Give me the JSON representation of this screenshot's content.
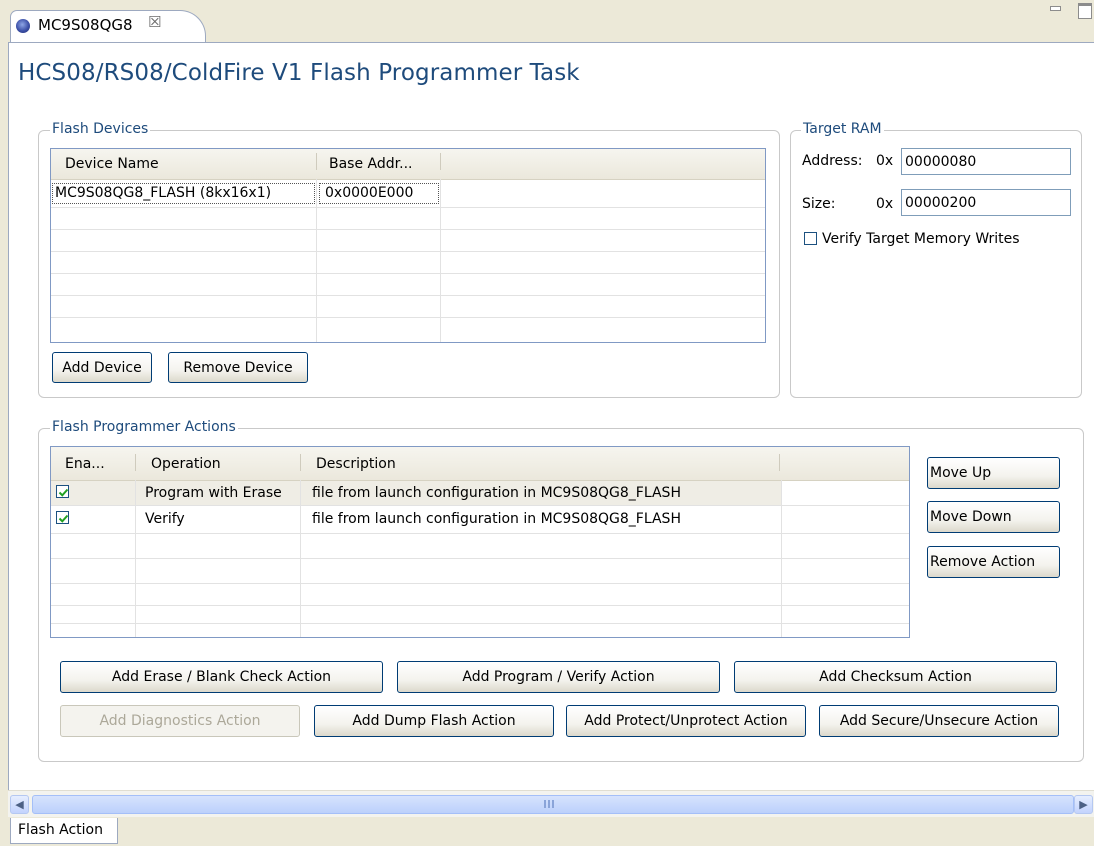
{
  "tab": {
    "title": "MC9S08QG8",
    "close_glyph": "☒"
  },
  "page": {
    "title": "HCS08/RS08/ColdFire V1 Flash Programmer Task"
  },
  "flash_devices": {
    "legend": "Flash Devices",
    "columns": [
      "Device Name",
      "Base Addr..."
    ],
    "rows": [
      {
        "device_name": "MC9S08QG8_FLASH (8kx16x1)",
        "base_addr": "0x0000E000"
      }
    ],
    "add_device_label": "Add Device",
    "remove_device_label": "Remove Device"
  },
  "target_ram": {
    "legend": "Target RAM",
    "address_label": "Address:",
    "address_prefix": "0x",
    "address_value": "00000080",
    "size_label": "Size:",
    "size_prefix": "0x",
    "size_value": "00000200",
    "verify_label": "Verify Target Memory Writes",
    "verify_checked": false
  },
  "actions": {
    "legend": "Flash Programmer Actions",
    "columns": [
      "Ena...",
      "Operation",
      "Description"
    ],
    "rows": [
      {
        "enabled": true,
        "operation": "Program with Erase",
        "description": "file from launch configuration in MC9S08QG8_FLASH"
      },
      {
        "enabled": true,
        "operation": "Verify",
        "description": "file from launch configuration in MC9S08QG8_FLASH"
      }
    ],
    "move_up_label": "Move Up",
    "move_down_label": "Move Down",
    "remove_action_label": "Remove Action",
    "add_erase_label": "Add Erase / Blank Check Action",
    "add_program_label": "Add Program / Verify Action",
    "add_checksum_label": "Add Checksum Action",
    "add_diagnostics_label": "Add Diagnostics Action",
    "add_dump_label": "Add Dump Flash Action",
    "add_protect_label": "Add Protect/Unprotect Action",
    "add_secure_label": "Add Secure/Unsecure Action"
  },
  "bottom_tab": {
    "label": "Flash Action"
  },
  "colors": {
    "title_blue": "#1e4b7c",
    "table_border": "#8099c4",
    "button_border": "#003c74",
    "selected_row": "#efede5"
  }
}
